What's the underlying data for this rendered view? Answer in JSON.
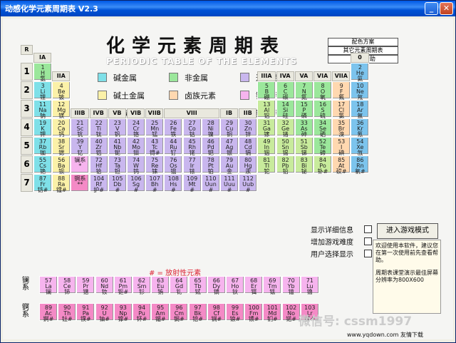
{
  "window": {
    "title": "动感化学元素周期表 V2.3"
  },
  "title": {
    "main": "化学元素周期表",
    "sub": "PERIODIC TABLE OF THE ELEMENTS"
  },
  "menu": [
    "配色方案",
    "其它元素周期表",
    "工具/帮助"
  ],
  "legend": [
    {
      "label": "碱金属",
      "color": "#7fe0e8"
    },
    {
      "label": "非金属",
      "color": "#9be79b"
    },
    {
      "label": "过度金属",
      "color": "#c9b7ee"
    },
    {
      "label": "碱土金属",
      "color": "#fbf1a8"
    },
    {
      "label": "卤族元素",
      "color": "#ffd8b0"
    },
    {
      "label": "镧　系",
      "color": "#f6b4ee"
    },
    {
      "label": "主族金属",
      "color": "#c8eb9c"
    },
    {
      "label": "稀有气体",
      "color": "#7cc4ed"
    },
    {
      "label": "锕　系",
      "color": "#f48ac6"
    }
  ],
  "groups": {
    "IA": "IA",
    "IIA": "IIA",
    "IIIB": "IIIB",
    "IVB": "IVB",
    "VB": "VB",
    "VIB": "VIB",
    "VIIB": "VIIB",
    "VIII": "VIII",
    "IB": "IB",
    "IIB": "IIB",
    "IIIA": "IIIA",
    "IVA": "IVA",
    "VA": "VA",
    "VIA": "VIA",
    "VIIA": "VIIA",
    "0": "0",
    "R": "R"
  },
  "periods": [
    "1",
    "2",
    "3",
    "4",
    "5",
    "6",
    "7"
  ],
  "elements": [
    {
      "n": "1",
      "s": "H",
      "c": "氢",
      "t": "n",
      "r": 1,
      "g": 1
    },
    {
      "n": "2",
      "s": "He",
      "c": "氦",
      "t": "g",
      "r": 1,
      "g": 18
    },
    {
      "n": "3",
      "s": "Li",
      "c": "锂",
      "t": "a",
      "r": 2,
      "g": 1
    },
    {
      "n": "4",
      "s": "Be",
      "c": "铍",
      "t": "e",
      "r": 2,
      "g": 2
    },
    {
      "n": "5",
      "s": "B",
      "c": "硼",
      "t": "n",
      "r": 2,
      "g": 13
    },
    {
      "n": "6",
      "s": "C",
      "c": "碳",
      "t": "n",
      "r": 2,
      "g": 14
    },
    {
      "n": "7",
      "s": "N",
      "c": "氮",
      "t": "n",
      "r": 2,
      "g": 15
    },
    {
      "n": "8",
      "s": "O",
      "c": "氧",
      "t": "n",
      "r": 2,
      "g": 16
    },
    {
      "n": "9",
      "s": "F",
      "c": "氟",
      "t": "h",
      "r": 2,
      "g": 17
    },
    {
      "n": "10",
      "s": "Ne",
      "c": "氖",
      "t": "g",
      "r": 2,
      "g": 18
    },
    {
      "n": "11",
      "s": "Na",
      "c": "钠",
      "t": "a",
      "r": 3,
      "g": 1
    },
    {
      "n": "12",
      "s": "Mg",
      "c": "镁",
      "t": "e",
      "r": 3,
      "g": 2
    },
    {
      "n": "13",
      "s": "Al",
      "c": "铝",
      "t": "m",
      "r": 3,
      "g": 13
    },
    {
      "n": "14",
      "s": "Si",
      "c": "硅",
      "t": "n",
      "r": 3,
      "g": 14
    },
    {
      "n": "15",
      "s": "P",
      "c": "磷",
      "t": "n",
      "r": 3,
      "g": 15
    },
    {
      "n": "16",
      "s": "S",
      "c": "硫",
      "t": "n",
      "r": 3,
      "g": 16
    },
    {
      "n": "17",
      "s": "Cl",
      "c": "氯",
      "t": "h",
      "r": 3,
      "g": 17
    },
    {
      "n": "18",
      "s": "Ar",
      "c": "氩",
      "t": "g",
      "r": 3,
      "g": 18
    },
    {
      "n": "19",
      "s": "K",
      "c": "钾",
      "t": "a",
      "r": 4,
      "g": 1
    },
    {
      "n": "20",
      "s": "Ca",
      "c": "钙",
      "t": "e",
      "r": 4,
      "g": 2
    },
    {
      "n": "21",
      "s": "Sc",
      "c": "钪",
      "t": "t",
      "r": 4,
      "g": 3
    },
    {
      "n": "22",
      "s": "Ti",
      "c": "钛",
      "t": "t",
      "r": 4,
      "g": 4
    },
    {
      "n": "23",
      "s": "V",
      "c": "钒",
      "t": "t",
      "r": 4,
      "g": 5
    },
    {
      "n": "24",
      "s": "Cr",
      "c": "铬",
      "t": "t",
      "r": 4,
      "g": 6
    },
    {
      "n": "25",
      "s": "Mn",
      "c": "锰",
      "t": "t",
      "r": 4,
      "g": 7
    },
    {
      "n": "26",
      "s": "Fe",
      "c": "铁",
      "t": "t",
      "r": 4,
      "g": 8
    },
    {
      "n": "27",
      "s": "Co",
      "c": "钴",
      "t": "t",
      "r": 4,
      "g": 9
    },
    {
      "n": "28",
      "s": "Ni",
      "c": "镍",
      "t": "t",
      "r": 4,
      "g": 10
    },
    {
      "n": "29",
      "s": "Cu",
      "c": "铜",
      "t": "t",
      "r": 4,
      "g": 11
    },
    {
      "n": "30",
      "s": "Zn",
      "c": "锌",
      "t": "t",
      "r": 4,
      "g": 12
    },
    {
      "n": "31",
      "s": "Ga",
      "c": "镓",
      "t": "m",
      "r": 4,
      "g": 13
    },
    {
      "n": "32",
      "s": "Ge",
      "c": "锗",
      "t": "m",
      "r": 4,
      "g": 14
    },
    {
      "n": "33",
      "s": "As",
      "c": "砷",
      "t": "n",
      "r": 4,
      "g": 15
    },
    {
      "n": "34",
      "s": "Se",
      "c": "硒",
      "t": "n",
      "r": 4,
      "g": 16
    },
    {
      "n": "35",
      "s": "Br",
      "c": "溴",
      "t": "h",
      "r": 4,
      "g": 17
    },
    {
      "n": "36",
      "s": "Kr",
      "c": "氪",
      "t": "g",
      "r": 4,
      "g": 18
    },
    {
      "n": "37",
      "s": "Rb",
      "c": "铷",
      "t": "a",
      "r": 5,
      "g": 1
    },
    {
      "n": "38",
      "s": "Sr",
      "c": "锶",
      "t": "e",
      "r": 5,
      "g": 2
    },
    {
      "n": "39",
      "s": "Y",
      "c": "钇",
      "t": "t",
      "r": 5,
      "g": 3
    },
    {
      "n": "40",
      "s": "Zr",
      "c": "锆",
      "t": "t",
      "r": 5,
      "g": 4
    },
    {
      "n": "41",
      "s": "Nb",
      "c": "铌",
      "t": "t",
      "r": 5,
      "g": 5
    },
    {
      "n": "42",
      "s": "Mo",
      "c": "钼",
      "t": "t",
      "r": 5,
      "g": 6
    },
    {
      "n": "43",
      "s": "Tc",
      "c": "锝#",
      "t": "t",
      "r": 5,
      "g": 7
    },
    {
      "n": "44",
      "s": "Ru",
      "c": "钌",
      "t": "t",
      "r": 5,
      "g": 8
    },
    {
      "n": "45",
      "s": "Rh",
      "c": "铑",
      "t": "t",
      "r": 5,
      "g": 9
    },
    {
      "n": "46",
      "s": "Pd",
      "c": "钯",
      "t": "t",
      "r": 5,
      "g": 10
    },
    {
      "n": "47",
      "s": "Ag",
      "c": "银",
      "t": "t",
      "r": 5,
      "g": 11
    },
    {
      "n": "48",
      "s": "Cd",
      "c": "镉",
      "t": "t",
      "r": 5,
      "g": 12
    },
    {
      "n": "49",
      "s": "In",
      "c": "铟",
      "t": "m",
      "r": 5,
      "g": 13
    },
    {
      "n": "50",
      "s": "Sn",
      "c": "锡",
      "t": "m",
      "r": 5,
      "g": 14
    },
    {
      "n": "51",
      "s": "Sb",
      "c": "锑",
      "t": "m",
      "r": 5,
      "g": 15
    },
    {
      "n": "52",
      "s": "Te",
      "c": "碲",
      "t": "n",
      "r": 5,
      "g": 16
    },
    {
      "n": "53",
      "s": "I",
      "c": "碘",
      "t": "h",
      "r": 5,
      "g": 17
    },
    {
      "n": "54",
      "s": "Xe",
      "c": "氙",
      "t": "g",
      "r": 5,
      "g": 18
    },
    {
      "n": "55",
      "s": "Cs",
      "c": "铯",
      "t": "a",
      "r": 6,
      "g": 1
    },
    {
      "n": "56",
      "s": "Ba",
      "c": "钡",
      "t": "e",
      "r": 6,
      "g": 2
    },
    {
      "n": "",
      "s": "镧系",
      "c": "*",
      "t": "l",
      "r": 6,
      "g": 3
    },
    {
      "n": "72",
      "s": "Hf",
      "c": "铪",
      "t": "t",
      "r": 6,
      "g": 4
    },
    {
      "n": "73",
      "s": "Ta",
      "c": "钽",
      "t": "t",
      "r": 6,
      "g": 5
    },
    {
      "n": "74",
      "s": "W",
      "c": "钨",
      "t": "t",
      "r": 6,
      "g": 6
    },
    {
      "n": "75",
      "s": "Re",
      "c": "铼",
      "t": "t",
      "r": 6,
      "g": 7
    },
    {
      "n": "76",
      "s": "Os",
      "c": "锇",
      "t": "t",
      "r": 6,
      "g": 8
    },
    {
      "n": "77",
      "s": "Ir",
      "c": "铱",
      "t": "t",
      "r": 6,
      "g": 9
    },
    {
      "n": "78",
      "s": "Pt",
      "c": "铂",
      "t": "t",
      "r": 6,
      "g": 10
    },
    {
      "n": "79",
      "s": "Au",
      "c": "金",
      "t": "t",
      "r": 6,
      "g": 11
    },
    {
      "n": "80",
      "s": "Hg",
      "c": "汞",
      "t": "t",
      "r": 6,
      "g": 12
    },
    {
      "n": "81",
      "s": "Tl",
      "c": "铊",
      "t": "m",
      "r": 6,
      "g": 13
    },
    {
      "n": "82",
      "s": "Pb",
      "c": "铅",
      "t": "m",
      "r": 6,
      "g": 14
    },
    {
      "n": "83",
      "s": "Bi",
      "c": "铋",
      "t": "m",
      "r": 6,
      "g": 15
    },
    {
      "n": "84",
      "s": "Po",
      "c": "钋#",
      "t": "m",
      "r": 6,
      "g": 16
    },
    {
      "n": "85",
      "s": "At",
      "c": "砹#",
      "t": "h",
      "r": 6,
      "g": 17
    },
    {
      "n": "86",
      "s": "Rn",
      "c": "氡#",
      "t": "g",
      "r": 6,
      "g": 18
    },
    {
      "n": "87",
      "s": "Fr",
      "c": "钫#",
      "t": "a",
      "r": 7,
      "g": 1
    },
    {
      "n": "88",
      "s": "Ra",
      "c": "镭#",
      "t": "e",
      "r": 7,
      "g": 2
    },
    {
      "n": "",
      "s": "锕系",
      "c": "**",
      "t": "c",
      "r": 7,
      "g": 3
    },
    {
      "n": "104",
      "s": "Rf",
      "c": "护#",
      "t": "t",
      "r": 7,
      "g": 4
    },
    {
      "n": "105",
      "s": "Db",
      "c": "#",
      "t": "t",
      "r": 7,
      "g": 5
    },
    {
      "n": "106",
      "s": "Sg",
      "c": "#",
      "t": "t",
      "r": 7,
      "g": 6
    },
    {
      "n": "107",
      "s": "Bh",
      "c": "#",
      "t": "t",
      "r": 7,
      "g": 7
    },
    {
      "n": "108",
      "s": "Hs",
      "c": "#",
      "t": "t",
      "r": 7,
      "g": 8
    },
    {
      "n": "109",
      "s": "Mt",
      "c": "#",
      "t": "t",
      "r": 7,
      "g": 9
    },
    {
      "n": "110",
      "s": "Uun",
      "c": "#",
      "t": "t",
      "r": 7,
      "g": 10
    },
    {
      "n": "111",
      "s": "Uuu",
      "c": "#",
      "t": "t",
      "r": 7,
      "g": 11
    },
    {
      "n": "112",
      "s": "Uub",
      "c": "#",
      "t": "t",
      "r": 7,
      "g": 12
    }
  ],
  "lanthanides": [
    {
      "n": "57",
      "s": "La",
      "c": "镧"
    },
    {
      "n": "58",
      "s": "Ce",
      "c": "铈"
    },
    {
      "n": "59",
      "s": "Pr",
      "c": "镨"
    },
    {
      "n": "60",
      "s": "Nd",
      "c": "钕"
    },
    {
      "n": "61",
      "s": "Pm",
      "c": "钷#"
    },
    {
      "n": "62",
      "s": "Sm",
      "c": "钐"
    },
    {
      "n": "63",
      "s": "Eu",
      "c": "铕"
    },
    {
      "n": "64",
      "s": "Gd",
      "c": "钆"
    },
    {
      "n": "65",
      "s": "Tb",
      "c": "铽"
    },
    {
      "n": "66",
      "s": "Dy",
      "c": "镝"
    },
    {
      "n": "67",
      "s": "Ho",
      "c": "钬"
    },
    {
      "n": "68",
      "s": "Er",
      "c": "铒"
    },
    {
      "n": "69",
      "s": "Tm",
      "c": "铥"
    },
    {
      "n": "70",
      "s": "Yb",
      "c": "镱"
    },
    {
      "n": "71",
      "s": "Lu",
      "c": "镥"
    }
  ],
  "actinides": [
    {
      "n": "89",
      "s": "Ac",
      "c": "锕#"
    },
    {
      "n": "90",
      "s": "Th",
      "c": "钍#"
    },
    {
      "n": "91",
      "s": "Pa",
      "c": "镤#"
    },
    {
      "n": "92",
      "s": "U",
      "c": "铀#"
    },
    {
      "n": "93",
      "s": "Np",
      "c": "镎#"
    },
    {
      "n": "94",
      "s": "Pu",
      "c": "钚#"
    },
    {
      "n": "95",
      "s": "Am",
      "c": "镅#"
    },
    {
      "n": "96",
      "s": "Cm",
      "c": "锔#"
    },
    {
      "n": "97",
      "s": "Bk",
      "c": "锫#"
    },
    {
      "n": "98",
      "s": "Cf",
      "c": "锎#"
    },
    {
      "n": "99",
      "s": "Es",
      "c": "锿#"
    },
    {
      "n": "100",
      "s": "Fm",
      "c": "镄#"
    },
    {
      "n": "101",
      "s": "Md",
      "c": "钔#"
    },
    {
      "n": "102",
      "s": "No",
      "c": "锘#"
    },
    {
      "n": "103",
      "s": "Lr",
      "c": "铹#"
    }
  ],
  "series_labels": {
    "la": "镧系",
    "ac": "锕系"
  },
  "radioactive": "# = 放射性元素",
  "options": [
    "显示详细信息",
    "增加游戏难度",
    "用户选择显示"
  ],
  "start_button": "进入游戏模式",
  "info": {
    "p1": "欢迎使用本软件，建议您在第一次使用前先查看帮助。",
    "p2": "周期表课堂演示最佳屏幕分辨率为800X600"
  },
  "watermark": "微信号: cssm1997",
  "footer": "www.yqdown.com 友情下载",
  "colors": {
    "n": "#9be79b",
    "g": "#7cc4ed",
    "a": "#7fe0e8",
    "e": "#fbf1a8",
    "t": "#c9b7ee",
    "m": "#c8eb9c",
    "h": "#ffd8b0",
    "l": "#f6b4ee",
    "c": "#f48ac6"
  }
}
